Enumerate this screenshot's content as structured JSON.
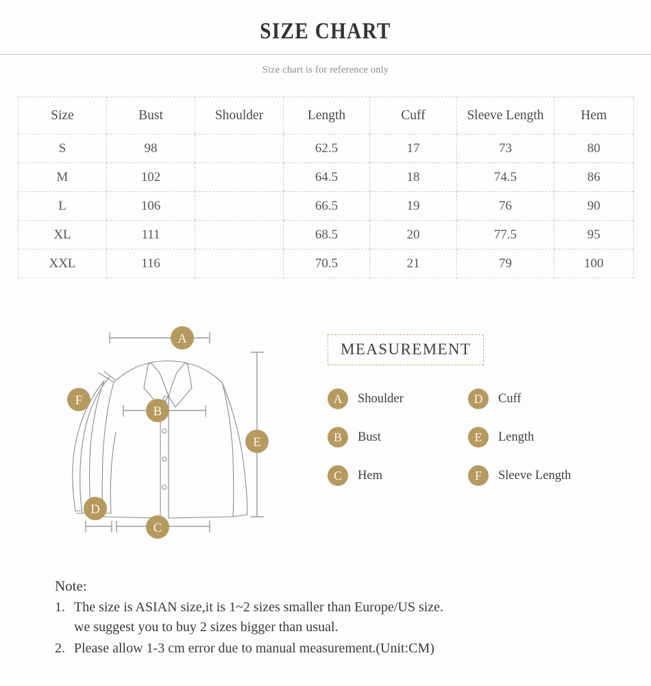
{
  "header": {
    "title": "SIZE CHART",
    "subtitle": "Size chart is for reference only"
  },
  "table": {
    "columns": [
      "Size",
      "Bust",
      "Shoulder",
      "Length",
      "Cuff",
      "Sleeve Length",
      "Hem"
    ],
    "rows": [
      {
        "size": "S",
        "bust": "98",
        "shoulder": "",
        "length": "62.5",
        "cuff": "17",
        "sleeve_length": "73",
        "hem": "80"
      },
      {
        "size": "M",
        "bust": "102",
        "shoulder": "",
        "length": "64.5",
        "cuff": "18",
        "sleeve_length": "74.5",
        "hem": "86"
      },
      {
        "size": "L",
        "bust": "106",
        "shoulder": "",
        "length": "66.5",
        "cuff": "19",
        "sleeve_length": "76",
        "hem": "90"
      },
      {
        "size": "XL",
        "bust": "111",
        "shoulder": "",
        "length": "68.5",
        "cuff": "20",
        "sleeve_length": "77.5",
        "hem": "95"
      },
      {
        "size": "XXL",
        "bust": "116",
        "shoulder": "",
        "length": "70.5",
        "cuff": "21",
        "sleeve_length": "79",
        "hem": "100"
      }
    ]
  },
  "diagram": {
    "markers": {
      "a": "A",
      "b": "B",
      "c": "C",
      "d": "D",
      "e": "E",
      "f": "F"
    }
  },
  "legend": {
    "title": "MEASUREMENT",
    "items": [
      {
        "key": "A",
        "label": "Shoulder"
      },
      {
        "key": "D",
        "label": "Cuff"
      },
      {
        "key": "B",
        "label": "Bust"
      },
      {
        "key": "E",
        "label": "Length"
      },
      {
        "key": "C",
        "label": "Hem"
      },
      {
        "key": "F",
        "label": "Sleeve Length"
      }
    ]
  },
  "note": {
    "heading": "Note:",
    "items": [
      {
        "number": "1.",
        "line1": "The size is ASIAN size,it is 1~2 sizes smaller than Europe/US size.",
        "line2": "we suggest you to buy 2 sizes bigger than usual."
      },
      {
        "number": "2.",
        "line1": "Please allow 1-3 cm error due to manual measurement.(Unit:CM)",
        "line2": ""
      }
    ]
  },
  "colors": {
    "accent": "#b5995f",
    "border": "#cfcfcf",
    "text": "#3a3a3a"
  }
}
